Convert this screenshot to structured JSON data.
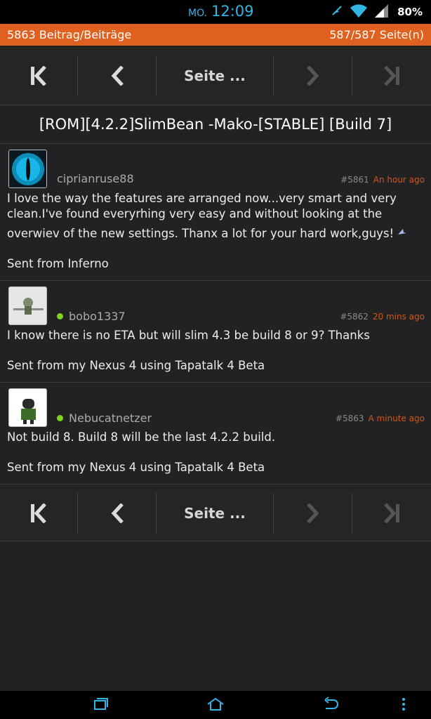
{
  "status_bar": {
    "day": "MO.",
    "time": "12:09",
    "battery": "80%",
    "icons": [
      "mute-icon",
      "wifi-icon",
      "signal-icon"
    ]
  },
  "info_bar": {
    "post_count": "5863 Beitrag/Beiträge",
    "page_count": "587/587 Seite(n)"
  },
  "pager": {
    "first_icon": "first-page-icon",
    "prev_icon": "prev-page-icon",
    "goto_label": "Seite ...",
    "next_icon": "next-page-icon",
    "last_icon": "last-page-icon"
  },
  "thread": {
    "title": "[ROM][4.2.2]SlimBean -Mako-[STABLE] [Build 7]"
  },
  "posts": [
    {
      "username": "ciprianruse88",
      "online": false,
      "number": "#5861",
      "time": "An hour ago",
      "body_line1": "I love the way the features are arranged now...very smart and very",
      "body_line2": "clean.I've found everyrhing very easy and without looking at the",
      "body_line3": "overwiev of the new settings. Thanx a lot for your hard work,guys!",
      "signature": "Sent from Inferno"
    },
    {
      "username": "bobo1337",
      "online": true,
      "number": "#5862",
      "time": "20 mins ago",
      "body_line1": "I know there is no ETA but will slim 4.3 be build 8 or 9? Thanks",
      "signature": "Sent from my Nexus 4 using Tapatalk 4 Beta"
    },
    {
      "username": "Nebucatnetzer",
      "online": true,
      "number": "#5863",
      "time": "A minute ago",
      "body_line1": "Not build 8. Build 8 will be the last 4.2.2 build.",
      "signature": "Sent from my Nexus 4 using Tapatalk 4 Beta"
    }
  ],
  "colors": {
    "accent": "#e0601f",
    "clock": "#33b5e5",
    "online": "#7ed321",
    "timestamp": "#d0561d"
  },
  "nav_bar": {
    "icons": [
      "recent-apps-icon",
      "home-icon",
      "back-icon",
      "menu-icon"
    ]
  }
}
